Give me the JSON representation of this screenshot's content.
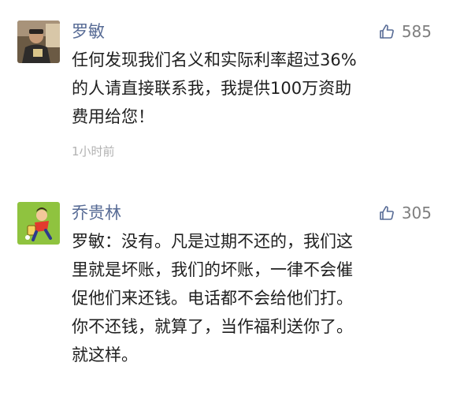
{
  "comments": [
    {
      "author": "罗敏",
      "likes": "585",
      "lines": [
        "任何发现我们名义和实际利率超过36%",
        "的人请直接联系我，我提供100万资助",
        "费用给您！"
      ],
      "time": "1小时前",
      "avatar_icon": "user-photo-avatar"
    },
    {
      "author": "乔贵林",
      "likes": "305",
      "lines": [
        "罗敏：没有。凡是过期不还的，我们这",
        "里就是坏账，我们的坏账，一律不会催",
        "促他们来还钱。电话都不会给他们打。",
        "你不还钱，就算了，当作福利送你了。",
        "就这样。"
      ],
      "avatar_icon": "cartoon-character-avatar"
    }
  ],
  "colors": {
    "author_name": "#576b95",
    "body_text": "#1f1f1f",
    "muted": "#b2b2b2",
    "like_icon": "#576b95",
    "avatar2_bg": "#8fc33f"
  }
}
